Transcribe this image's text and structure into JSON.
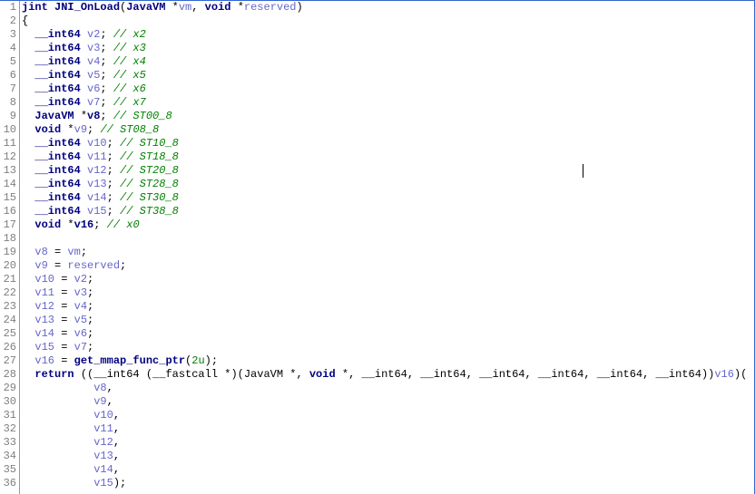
{
  "lines": [
    {
      "n": 1,
      "segments": [
        {
          "t": "jint ",
          "c": "tp"
        },
        {
          "t": "JNI_OnLoad",
          "c": "fn"
        },
        {
          "t": "(",
          "c": "op"
        },
        {
          "t": "JavaVM ",
          "c": "tp"
        },
        {
          "t": "*",
          "c": "op"
        },
        {
          "t": "vm",
          "c": "id"
        },
        {
          "t": ", ",
          "c": "op"
        },
        {
          "t": "void ",
          "c": "tp"
        },
        {
          "t": "*",
          "c": "op"
        },
        {
          "t": "reserved",
          "c": "id"
        },
        {
          "t": ")",
          "c": "op"
        }
      ]
    },
    {
      "n": 2,
      "segments": [
        {
          "t": "{",
          "c": "op"
        }
      ]
    },
    {
      "n": 3,
      "segments": [
        {
          "t": "  __int64 ",
          "c": "tp"
        },
        {
          "t": "v2",
          "c": "id"
        },
        {
          "t": "; ",
          "c": "op"
        },
        {
          "t": "// x2",
          "c": "cm"
        }
      ]
    },
    {
      "n": 4,
      "segments": [
        {
          "t": "  __int64 ",
          "c": "tp"
        },
        {
          "t": "v3",
          "c": "id"
        },
        {
          "t": "; ",
          "c": "op"
        },
        {
          "t": "// x3",
          "c": "cm"
        }
      ]
    },
    {
      "n": 5,
      "segments": [
        {
          "t": "  __int64 ",
          "c": "tp"
        },
        {
          "t": "v4",
          "c": "id"
        },
        {
          "t": "; ",
          "c": "op"
        },
        {
          "t": "// x4",
          "c": "cm"
        }
      ]
    },
    {
      "n": 6,
      "segments": [
        {
          "t": "  __int64 ",
          "c": "tp"
        },
        {
          "t": "v5",
          "c": "id"
        },
        {
          "t": "; ",
          "c": "op"
        },
        {
          "t": "// x5",
          "c": "cm"
        }
      ]
    },
    {
      "n": 7,
      "segments": [
        {
          "t": "  __int64 ",
          "c": "tp"
        },
        {
          "t": "v6",
          "c": "id"
        },
        {
          "t": "; ",
          "c": "op"
        },
        {
          "t": "// x6",
          "c": "cm"
        }
      ]
    },
    {
      "n": 8,
      "segments": [
        {
          "t": "  __int64 ",
          "c": "tp"
        },
        {
          "t": "v7",
          "c": "id"
        },
        {
          "t": "; ",
          "c": "op"
        },
        {
          "t": "// x7",
          "c": "cm"
        }
      ]
    },
    {
      "n": 9,
      "segments": [
        {
          "t": "  JavaVM ",
          "c": "tp"
        },
        {
          "t": "*",
          "c": "op"
        },
        {
          "t": "v8",
          "c": "fn"
        },
        {
          "t": "; ",
          "c": "op"
        },
        {
          "t": "// ST00_8",
          "c": "cm"
        }
      ]
    },
    {
      "n": 10,
      "segments": [
        {
          "t": "  void ",
          "c": "tp"
        },
        {
          "t": "*",
          "c": "op"
        },
        {
          "t": "v9",
          "c": "id"
        },
        {
          "t": "; ",
          "c": "op"
        },
        {
          "t": "// ST08_8",
          "c": "cm"
        }
      ]
    },
    {
      "n": 11,
      "segments": [
        {
          "t": "  __int64 ",
          "c": "tp"
        },
        {
          "t": "v10",
          "c": "id"
        },
        {
          "t": "; ",
          "c": "op"
        },
        {
          "t": "// ST10_8",
          "c": "cm"
        }
      ]
    },
    {
      "n": 12,
      "segments": [
        {
          "t": "  __int64 ",
          "c": "tp"
        },
        {
          "t": "v11",
          "c": "id"
        },
        {
          "t": "; ",
          "c": "op"
        },
        {
          "t": "// ST18_8",
          "c": "cm"
        }
      ]
    },
    {
      "n": 13,
      "segments": [
        {
          "t": "  __int64 ",
          "c": "tp"
        },
        {
          "t": "v12",
          "c": "id"
        },
        {
          "t": "; ",
          "c": "op"
        },
        {
          "t": "// ST20_8",
          "c": "cm"
        }
      ]
    },
    {
      "n": 14,
      "segments": [
        {
          "t": "  __int64 ",
          "c": "tp"
        },
        {
          "t": "v13",
          "c": "id"
        },
        {
          "t": "; ",
          "c": "op"
        },
        {
          "t": "// ST28_8",
          "c": "cm"
        }
      ]
    },
    {
      "n": 15,
      "segments": [
        {
          "t": "  __int64 ",
          "c": "tp"
        },
        {
          "t": "v14",
          "c": "id"
        },
        {
          "t": "; ",
          "c": "op"
        },
        {
          "t": "// ST30_8",
          "c": "cm"
        }
      ]
    },
    {
      "n": 16,
      "segments": [
        {
          "t": "  __int64 ",
          "c": "tp"
        },
        {
          "t": "v15",
          "c": "id"
        },
        {
          "t": "; ",
          "c": "op"
        },
        {
          "t": "// ST38_8",
          "c": "cm"
        }
      ]
    },
    {
      "n": 17,
      "segments": [
        {
          "t": "  void ",
          "c": "tp"
        },
        {
          "t": "*",
          "c": "op"
        },
        {
          "t": "v16",
          "c": "fn"
        },
        {
          "t": "; ",
          "c": "op"
        },
        {
          "t": "// x0",
          "c": "cm"
        }
      ]
    },
    {
      "n": 18,
      "segments": []
    },
    {
      "n": 19,
      "segments": [
        {
          "t": "  ",
          "c": "op"
        },
        {
          "t": "v8",
          "c": "id"
        },
        {
          "t": " = ",
          "c": "op"
        },
        {
          "t": "vm",
          "c": "id"
        },
        {
          "t": ";",
          "c": "op"
        }
      ]
    },
    {
      "n": 20,
      "segments": [
        {
          "t": "  ",
          "c": "op"
        },
        {
          "t": "v9",
          "c": "id"
        },
        {
          "t": " = ",
          "c": "op"
        },
        {
          "t": "reserved",
          "c": "id"
        },
        {
          "t": ";",
          "c": "op"
        }
      ]
    },
    {
      "n": 21,
      "segments": [
        {
          "t": "  ",
          "c": "op"
        },
        {
          "t": "v10",
          "c": "id"
        },
        {
          "t": " = ",
          "c": "op"
        },
        {
          "t": "v2",
          "c": "id"
        },
        {
          "t": ";",
          "c": "op"
        }
      ]
    },
    {
      "n": 22,
      "segments": [
        {
          "t": "  ",
          "c": "op"
        },
        {
          "t": "v11",
          "c": "id"
        },
        {
          "t": " = ",
          "c": "op"
        },
        {
          "t": "v3",
          "c": "id"
        },
        {
          "t": ";",
          "c": "op"
        }
      ]
    },
    {
      "n": 23,
      "segments": [
        {
          "t": "  ",
          "c": "op"
        },
        {
          "t": "v12",
          "c": "id"
        },
        {
          "t": " = ",
          "c": "op"
        },
        {
          "t": "v4",
          "c": "id"
        },
        {
          "t": ";",
          "c": "op"
        }
      ]
    },
    {
      "n": 24,
      "segments": [
        {
          "t": "  ",
          "c": "op"
        },
        {
          "t": "v13",
          "c": "id"
        },
        {
          "t": " = ",
          "c": "op"
        },
        {
          "t": "v5",
          "c": "id"
        },
        {
          "t": ";",
          "c": "op"
        }
      ]
    },
    {
      "n": 25,
      "segments": [
        {
          "t": "  ",
          "c": "op"
        },
        {
          "t": "v14",
          "c": "id"
        },
        {
          "t": " = ",
          "c": "op"
        },
        {
          "t": "v6",
          "c": "id"
        },
        {
          "t": ";",
          "c": "op"
        }
      ]
    },
    {
      "n": 26,
      "segments": [
        {
          "t": "  ",
          "c": "op"
        },
        {
          "t": "v15",
          "c": "id"
        },
        {
          "t": " = ",
          "c": "op"
        },
        {
          "t": "v7",
          "c": "id"
        },
        {
          "t": ";",
          "c": "op"
        }
      ]
    },
    {
      "n": 27,
      "segments": [
        {
          "t": "  ",
          "c": "op"
        },
        {
          "t": "v16",
          "c": "id"
        },
        {
          "t": " = ",
          "c": "op"
        },
        {
          "t": "get_mmap_func_ptr",
          "c": "fn"
        },
        {
          "t": "(",
          "c": "op"
        },
        {
          "t": "2u",
          "c": "num"
        },
        {
          "t": ");",
          "c": "op"
        }
      ]
    },
    {
      "n": 28,
      "segments": [
        {
          "t": "  return ",
          "c": "kw"
        },
        {
          "t": "((__int64 (__fastcall *)(JavaVM *, ",
          "c": "op"
        },
        {
          "t": "void ",
          "c": "tp"
        },
        {
          "t": "*, __int64, __int64, __int64, __int64, __int64, __int64))",
          "c": "op"
        },
        {
          "t": "v16",
          "c": "id"
        },
        {
          "t": ")(",
          "c": "op"
        }
      ]
    },
    {
      "n": 29,
      "segments": [
        {
          "t": "           ",
          "c": "op"
        },
        {
          "t": "v8",
          "c": "id"
        },
        {
          "t": ",",
          "c": "op"
        }
      ]
    },
    {
      "n": 30,
      "segments": [
        {
          "t": "           ",
          "c": "op"
        },
        {
          "t": "v9",
          "c": "id"
        },
        {
          "t": ",",
          "c": "op"
        }
      ]
    },
    {
      "n": 31,
      "segments": [
        {
          "t": "           ",
          "c": "op"
        },
        {
          "t": "v10",
          "c": "id"
        },
        {
          "t": ",",
          "c": "op"
        }
      ]
    },
    {
      "n": 32,
      "segments": [
        {
          "t": "           ",
          "c": "op"
        },
        {
          "t": "v11",
          "c": "id"
        },
        {
          "t": ",",
          "c": "op"
        }
      ]
    },
    {
      "n": 33,
      "segments": [
        {
          "t": "           ",
          "c": "op"
        },
        {
          "t": "v12",
          "c": "id"
        },
        {
          "t": ",",
          "c": "op"
        }
      ]
    },
    {
      "n": 34,
      "segments": [
        {
          "t": "           ",
          "c": "op"
        },
        {
          "t": "v13",
          "c": "id"
        },
        {
          "t": ",",
          "c": "op"
        }
      ]
    },
    {
      "n": 35,
      "segments": [
        {
          "t": "           ",
          "c": "op"
        },
        {
          "t": "v14",
          "c": "id"
        },
        {
          "t": ",",
          "c": "op"
        }
      ]
    },
    {
      "n": 36,
      "segments": [
        {
          "t": "           ",
          "c": "op"
        },
        {
          "t": "v15",
          "c": "id"
        },
        {
          "t": ");",
          "c": "op"
        }
      ]
    }
  ]
}
